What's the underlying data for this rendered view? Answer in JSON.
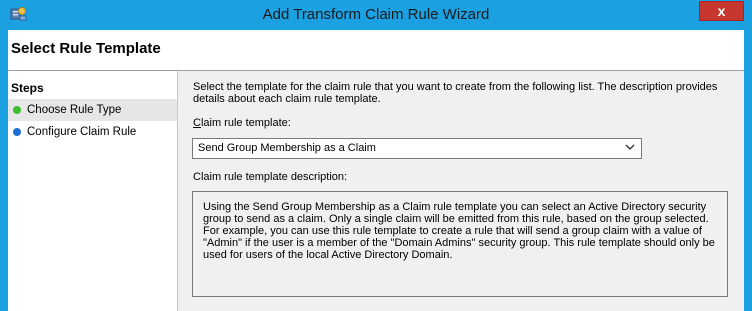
{
  "window": {
    "title": "Add Transform Claim Rule Wizard",
    "close_label": "x",
    "icon": "server-snapin-icon",
    "accent": "#1ba0e1"
  },
  "header": {
    "title": "Select Rule Template"
  },
  "steps": {
    "heading": "Steps",
    "items": [
      {
        "label": "Choose Rule Type",
        "status_color": "#3bbf2e",
        "selected": true
      },
      {
        "label": "Configure Claim Rule",
        "status_color": "#1f6fd6",
        "selected": false
      }
    ]
  },
  "main": {
    "instructions": "Select the template for the claim rule that you want to create from the following list. The description provides details about each claim rule template.",
    "template_label_prefix": "C",
    "template_label_rest": "laim rule template:",
    "template_selected": "Send Group Membership as a Claim",
    "description_label": "Claim rule template description:",
    "description": "Using the Send Group Membership as a Claim rule template you can select an Active Directory security group to send as a claim. Only a single claim will be emitted from this rule, based on the group selected. For example, you can use this rule template to create a rule that will send a group claim with a value of \"Admin\" if the user is a member of the \"Domain Admins\" security group.  This rule template should only be used for users of the local Active Directory Domain."
  }
}
